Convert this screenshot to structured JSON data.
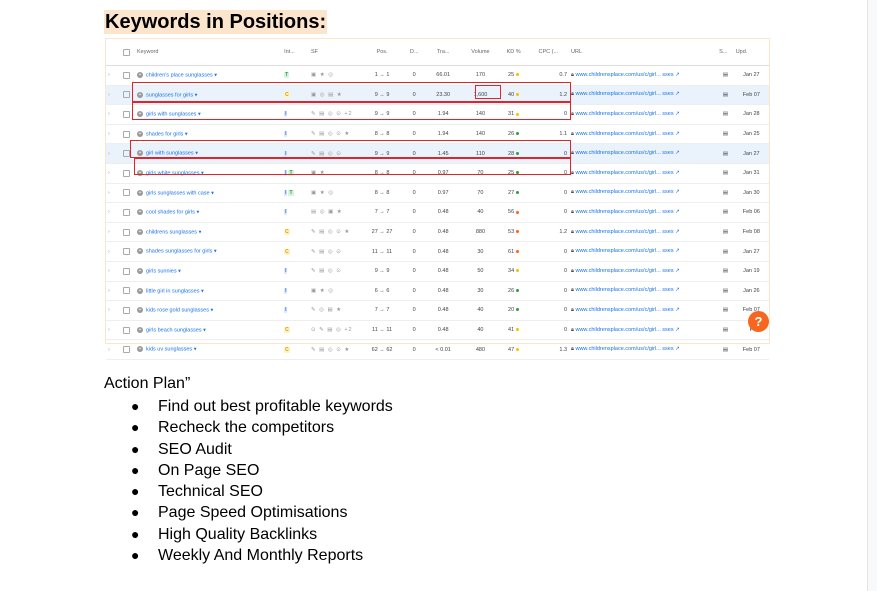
{
  "heading": "Keywords in Positions:",
  "table": {
    "columns": [
      "Keyword",
      "Int...",
      "SF",
      "Pos.",
      "D...",
      "Tra...",
      "Volume",
      "KD %",
      "CPC (...",
      "URL",
      "S...",
      "Upd."
    ],
    "rows": [
      {
        "keyword": "children's place sunglasses",
        "intent": [
          "T"
        ],
        "sf": "▣ ★ ◎",
        "pos_from": "1",
        "pos_to": "1",
        "diff": "0",
        "traffic": "66.01",
        "volume": "170",
        "kd": "25",
        "kd_color": "#f2c200",
        "cpc": "0.7",
        "url": "www.childrensplace.com/us/c/girl... sses",
        "upd": "Jan 27"
      },
      {
        "keyword": "sunglasses for girls",
        "intent": [
          "C"
        ],
        "sf": "▣ ◎ ▤ ★",
        "pos_from": "9",
        "pos_to": "9",
        "diff": "0",
        "traffic": "23.30",
        "volume": "1,600",
        "kd": "40",
        "kd_color": "#f2c200",
        "cpc": "1.2",
        "url": "www.childrensplace.com/us/c/girl... sses",
        "upd": "Feb 07"
      },
      {
        "keyword": "girls with sunglasses",
        "intent": [
          "I"
        ],
        "sf": "✎ ▤ ◎ ⊙ +2",
        "pos_from": "9",
        "pos_to": "9",
        "diff": "0",
        "traffic": "1.94",
        "volume": "140",
        "kd": "31",
        "kd_color": "#f2c200",
        "cpc": "0",
        "url": "www.childrensplace.com/us/c/girl... sses",
        "upd": "Jan 28"
      },
      {
        "keyword": "shades for girls",
        "intent": [
          "I"
        ],
        "sf": "✎ ▤ ◎ ⊙ ★",
        "pos_from": "8",
        "pos_to": "8",
        "diff": "0",
        "traffic": "1.94",
        "volume": "140",
        "kd": "26",
        "kd_color": "#2f9e44",
        "cpc": "1.1",
        "url": "www.childrensplace.com/us/c/girl... sses",
        "upd": "Jan 25"
      },
      {
        "keyword": "girl with sunglasses",
        "intent": [
          "I"
        ],
        "sf": "✎ ▤ ◎ ⊙",
        "pos_from": "9",
        "pos_to": "9",
        "diff": "0",
        "traffic": "1.45",
        "volume": "110",
        "kd": "28",
        "kd_color": "#2f9e44",
        "cpc": "0",
        "url": "www.childrensplace.com/us/c/girl... sses",
        "upd": "Jan 27"
      },
      {
        "keyword": "girls white sunglasses",
        "intent": [
          "I",
          "T"
        ],
        "sf": "▣ ★",
        "pos_from": "8",
        "pos_to": "8",
        "diff": "0",
        "traffic": "0.97",
        "volume": "70",
        "kd": "25",
        "kd_color": "#2f9e44",
        "cpc": "0",
        "url": "www.childrensplace.com/us/c/girl... sses",
        "upd": "Jan 31"
      },
      {
        "keyword": "girls sunglasses with case",
        "intent": [
          "I",
          "T"
        ],
        "sf": "▣ ★ ◎",
        "pos_from": "8",
        "pos_to": "8",
        "diff": "0",
        "traffic": "0.97",
        "volume": "70",
        "kd": "27",
        "kd_color": "#2f9e44",
        "cpc": "0",
        "url": "www.childrensplace.com/us/c/girl... sses",
        "upd": "Jan 30"
      },
      {
        "keyword": "cool shades for girls",
        "intent": [
          "I"
        ],
        "sf": "▤ ◎ ▣ ★",
        "pos_from": "7",
        "pos_to": "7",
        "diff": "0",
        "traffic": "0.48",
        "volume": "40",
        "kd": "56",
        "kd_color": "#f7661e",
        "cpc": "0",
        "url": "www.childrensplace.com/us/c/girl... sses",
        "upd": "Feb 06"
      },
      {
        "keyword": "childrens sunglasses",
        "intent": [
          "C"
        ],
        "sf": "✎ ▤ ◎ ⊙ ★",
        "pos_from": "27",
        "pos_to": "27",
        "diff": "0",
        "traffic": "0.48",
        "volume": "880",
        "kd": "53",
        "kd_color": "#f7661e",
        "cpc": "1.2",
        "url": "www.childrensplace.com/us/c/girl... sses",
        "upd": "Feb 08"
      },
      {
        "keyword": "shades sunglasses for girls",
        "intent": [
          "C"
        ],
        "sf": "✎ ▤ ◎ ⊙",
        "pos_from": "11",
        "pos_to": "11",
        "diff": "0",
        "traffic": "0.48",
        "volume": "30",
        "kd": "61",
        "kd_color": "#f7661e",
        "cpc": "0",
        "url": "www.childrensplace.com/us/c/girl... sses",
        "upd": "Jan 27"
      },
      {
        "keyword": "girls sunnies",
        "intent": [
          "I"
        ],
        "sf": "✎ ▤ ◎ ⊙",
        "pos_from": "9",
        "pos_to": "9",
        "diff": "0",
        "traffic": "0.48",
        "volume": "50",
        "kd": "34",
        "kd_color": "#f2c200",
        "cpc": "0",
        "url": "www.childrensplace.com/us/c/girl... sses",
        "upd": "Jan 19"
      },
      {
        "keyword": "little girl in sunglasses",
        "intent": [
          "I"
        ],
        "sf": "▣ ★ ◎",
        "pos_from": "6",
        "pos_to": "6",
        "diff": "0",
        "traffic": "0.48",
        "volume": "30",
        "kd": "26",
        "kd_color": "#2f9e44",
        "cpc": "0",
        "url": "www.childrensplace.com/us/c/girl... sses",
        "upd": "Jan 26"
      },
      {
        "keyword": "kids rose gold sunglasses",
        "intent": [
          "I"
        ],
        "sf": "✎ ◎ ▤ ★",
        "pos_from": "7",
        "pos_to": "7",
        "diff": "0",
        "traffic": "0.48",
        "volume": "40",
        "kd": "20",
        "kd_color": "#2f9e44",
        "cpc": "0",
        "url": "www.childrensplace.com/us/c/girl... sses",
        "upd": "Feb 07"
      },
      {
        "keyword": "girls beach sunglasses",
        "intent": [
          "C"
        ],
        "sf": "⊙ ✎ ▤ ◎ +2",
        "pos_from": "11",
        "pos_to": "11",
        "diff": "0",
        "traffic": "0.48",
        "volume": "40",
        "kd": "41",
        "kd_color": "#f2c200",
        "cpc": "0",
        "url": "www.childrensplace.com/us/c/girl... sses",
        "upd": "F"
      },
      {
        "keyword": "kids uv sunglasses",
        "intent": [
          "C"
        ],
        "sf": "✎ ▤ ◎ ⊙ ★",
        "pos_from": "62",
        "pos_to": "62",
        "diff": "0",
        "traffic": "< 0.01",
        "volume": "480",
        "kd": "47",
        "kd_color": "#f2c200",
        "cpc": "1.3",
        "url": "www.childrensplace.com/us/c/girl... sses",
        "upd": "Feb 07"
      }
    ]
  },
  "help_icon": "?",
  "plan_title": "Action Plan”",
  "plan_items": [
    "Find out best profitable keywords",
    "Recheck the competitors",
    "SEO Audit",
    "On Page SEO",
    "Technical SEO",
    "Page Speed Optimisations",
    "High Quality Backlinks",
    "Weekly And Monthly Reports"
  ],
  "bullet_glyph": "●",
  "colors": {
    "heading_highlight": "#fce5cd",
    "highlight_box": "#e0242b",
    "link": "#1a73e8",
    "help_button": "#f7661e"
  }
}
